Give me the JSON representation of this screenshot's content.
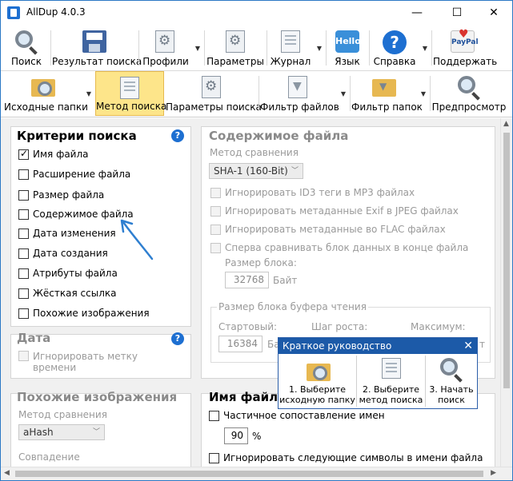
{
  "window": {
    "title": "AllDup 4.0.3",
    "minimize": "—",
    "maximize": "☐",
    "close": "✕"
  },
  "toolbar_main": [
    {
      "label": "Поиск",
      "icon": "search-icon"
    },
    {
      "label": "Результат поиска",
      "icon": "save-icon"
    },
    {
      "label": "Профили",
      "icon": "profile-icon"
    },
    {
      "label": "Параметры",
      "icon": "gear-icon"
    },
    {
      "label": "Журнал",
      "icon": "log-icon"
    },
    {
      "label": "Язык",
      "icon": "hello-icon",
      "icon_text": "Hello"
    },
    {
      "label": "Справка",
      "icon": "help-icon",
      "icon_text": "?"
    },
    {
      "label": "Поддержать",
      "icon": "paypal-icon",
      "icon_text": "PayPal"
    }
  ],
  "toolbar_sub": [
    {
      "label": "Исходные папки",
      "icon": "folder-search-icon"
    },
    {
      "label": "Метод поиска",
      "icon": "search-method-icon",
      "active": true
    },
    {
      "label": "Параметры поиска",
      "icon": "search-params-icon"
    },
    {
      "label": "Фильтр файлов",
      "icon": "file-filter-icon"
    },
    {
      "label": "Фильтр папок",
      "icon": "folder-filter-icon"
    },
    {
      "label": "Предпросмотр",
      "icon": "preview-icon"
    }
  ],
  "criteria": {
    "title": "Критерии поиска",
    "items": [
      {
        "label": "Имя файла",
        "checked": true
      },
      {
        "label": "Расширение файла",
        "checked": false
      },
      {
        "label": "Размер файла",
        "checked": false
      },
      {
        "label": "Содержимое файла",
        "checked": false
      },
      {
        "label": "Дата изменения",
        "checked": false
      },
      {
        "label": "Дата создания",
        "checked": false
      },
      {
        "label": "Атрибуты файла",
        "checked": false
      },
      {
        "label": "Жёсткая ссылка",
        "checked": false
      },
      {
        "label": "Похожие изображения",
        "checked": false
      }
    ]
  },
  "date_group": {
    "title": "Дата",
    "ignore_label_line1": "Игнорировать метку",
    "ignore_label_line2": "времени"
  },
  "similar_images": {
    "title": "Похожие изображения",
    "method_label": "Метод сравнения",
    "method_value": "aHash",
    "match_label": "Совпадение"
  },
  "file_content": {
    "title": "Содержимое файла",
    "method_label": "Метод сравнения",
    "method_value": "SHA-1 (160-Bit)",
    "options": [
      "Игнорировать ID3 теги в MP3 файлах",
      "Игнорировать метаданные Exif в JPEG файлах",
      "Игнорировать метаданные во FLAC файлах",
      "Сперва сравнивать блок данных в конце файла"
    ],
    "block_size_label": "Размер блока:",
    "block_size_value": "32768",
    "block_size_unit": "Байт",
    "buffer": {
      "title": "Размер блока буфера чтения",
      "start_label": "Стартовый:",
      "start_value": "16384",
      "start_unit_partial": "Ба",
      "step_label": "Шаг роста:",
      "max_label": "Максимум:",
      "max_unit_partial": "т"
    }
  },
  "file_name": {
    "title": "Имя файла",
    "partial_label": "Частичное сопоставление имен",
    "partial_value": "90",
    "partial_unit": "%",
    "ignore_chars_label": "Игнорировать следующие символы в имени файла"
  },
  "quick_guide": {
    "title": "Краткое руководство",
    "close": "✕",
    "steps": [
      {
        "line1": "1. Выберите",
        "line2": "исходную папку"
      },
      {
        "line1": "2. Выберите",
        "line2": "метод поиска"
      },
      {
        "line1": "3. Начать",
        "line2": "поиск"
      }
    ]
  }
}
